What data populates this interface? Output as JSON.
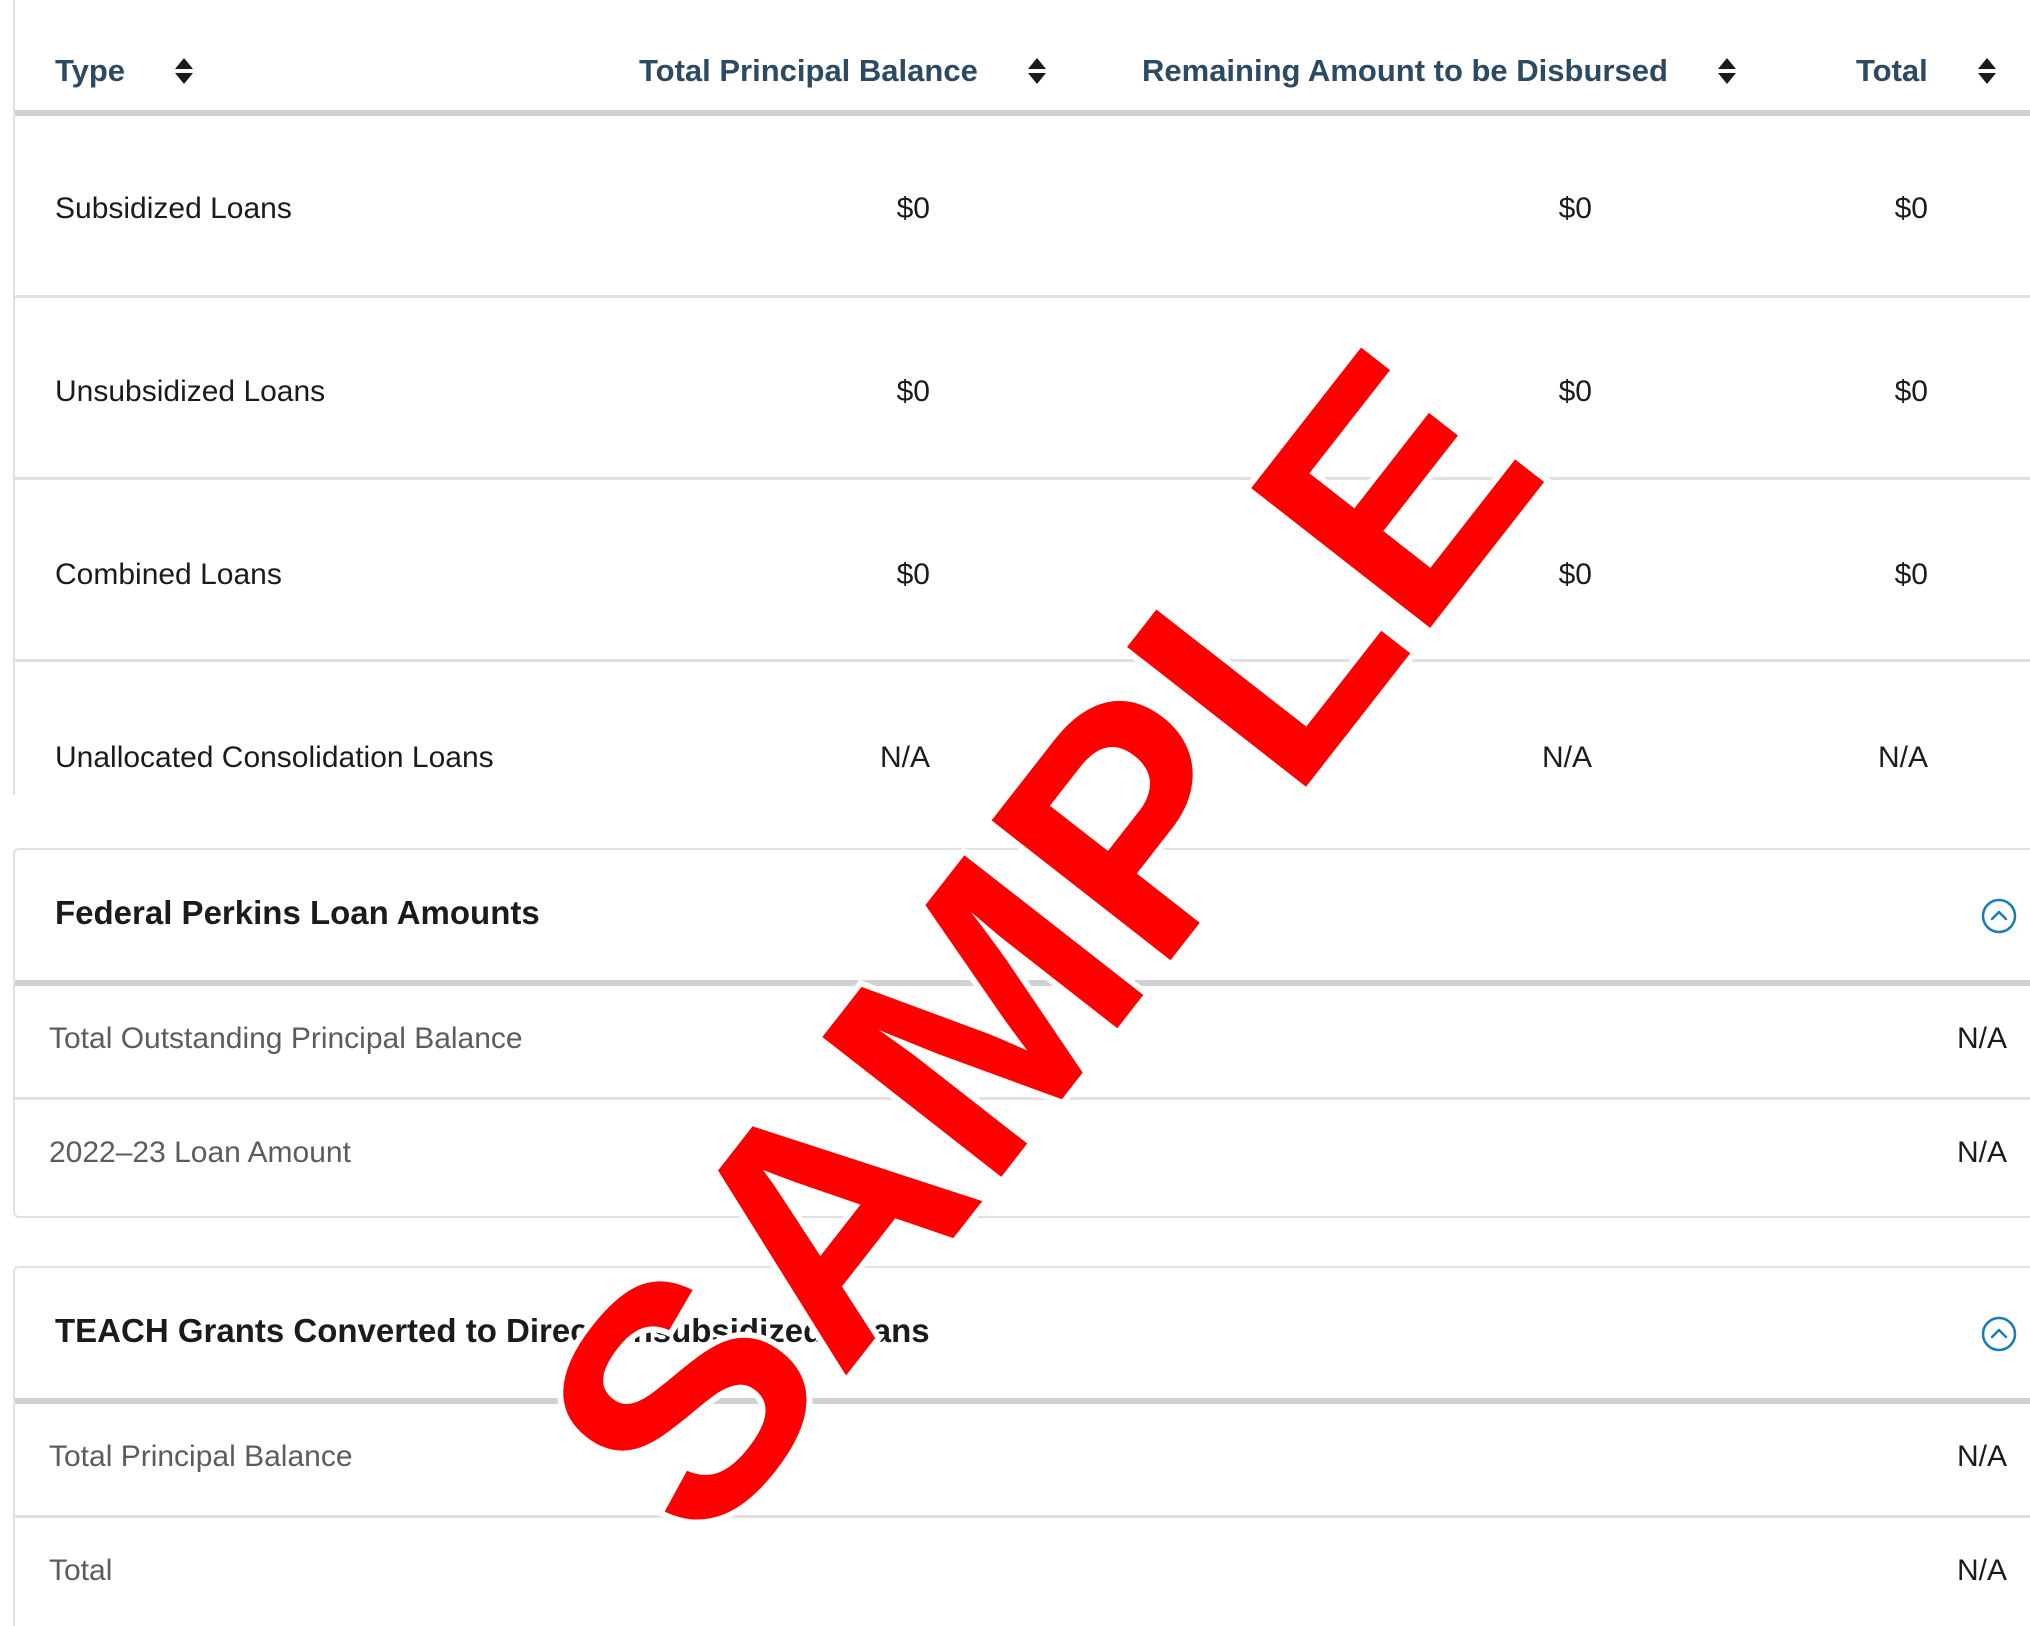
{
  "loans_table": {
    "columns": [
      {
        "label": "Type"
      },
      {
        "label": "Total Principal Balance"
      },
      {
        "label": "Remaining Amount to be Disbursed"
      },
      {
        "label": "Total"
      }
    ],
    "rows": [
      {
        "type": "Subsidized Loans",
        "principal": "$0",
        "remaining": "$0",
        "total": "$0"
      },
      {
        "type": "Unsubsidized Loans",
        "principal": "$0",
        "remaining": "$0",
        "total": "$0"
      },
      {
        "type": "Combined Loans",
        "principal": "$0",
        "remaining": "$0",
        "total": "$0"
      },
      {
        "type": "Unallocated Consolidation Loans",
        "principal": "N/A",
        "remaining": "N/A",
        "total": "N/A"
      }
    ],
    "sort_icon": "sort-icon"
  },
  "perkins": {
    "title": "Federal Perkins Loan Amounts",
    "toggle_icon": "chevron-up-circle-icon",
    "rows": [
      {
        "label": "Total Outstanding Principal Balance",
        "value": "N/A"
      },
      {
        "label": "2022–23 Loan Amount",
        "value": "N/A"
      }
    ]
  },
  "teach": {
    "title": "TEACH Grants Converted to Direct Unsubsidized Loans",
    "toggle_icon": "chevron-up-circle-icon",
    "rows": [
      {
        "label": "Total Principal Balance",
        "value": "N/A"
      },
      {
        "label": "Total",
        "value": "N/A"
      }
    ]
  },
  "watermark": {
    "text": "SAMPLE",
    "color": "#ff0000"
  },
  "colors": {
    "header_text": "#2d4a63",
    "toggle": "#1a7bb8",
    "border": "#dfe1e2"
  }
}
